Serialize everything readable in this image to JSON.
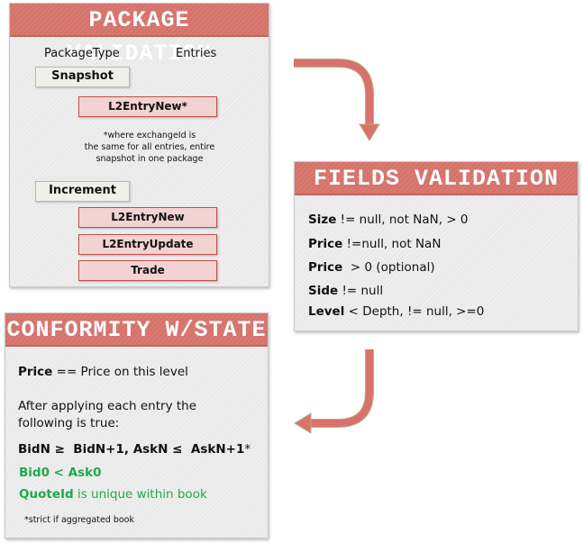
{
  "package_validation": {
    "title": "PACKAGE VALIDATION",
    "col_package_type": "PackageType",
    "col_entries": "Entries",
    "snapshot": {
      "label": "Snapshot",
      "entries": [
        "L2EntryNew*"
      ],
      "note": [
        "*where exchangeId is",
        "the same for all entries, entire",
        "snapshot in one package"
      ]
    },
    "increment": {
      "label": "Increment",
      "entries": [
        "L2EntryNew",
        "L2EntryUpdate",
        "Trade"
      ]
    }
  },
  "fields_validation": {
    "title": "FIELDS VALIDATION",
    "rules": [
      {
        "field": "Size",
        "rule": " != null, not NaN, > 0"
      },
      {
        "field": "Price",
        "rule": " !=null, not NaN"
      },
      {
        "field": "Price",
        "rule": "  > 0 (optional)"
      },
      {
        "field": "Side",
        "rule": " != null"
      },
      {
        "field": "Level",
        "rule": " < Depth, != null, >=0"
      }
    ]
  },
  "conformity": {
    "title": "CONFORMITY W/STATE",
    "price_field": "Price",
    "price_rule": " == Price on this level",
    "after_line1": "After applying each entry the",
    "after_line2": "following is true:",
    "ordering": "BidN ≥  BidN+1, AskN ≤  AskN+1",
    "ordering_mark": "*",
    "bid_ask": "Bid0 < Ask0",
    "quote_field": "QuoteId",
    "quote_rule": " is unique within book",
    "footnote": "*strict if aggregated book"
  },
  "colors": {
    "header": "#d97a73",
    "entry_fill": "#f3d3d1",
    "entry_border": "#c0504d",
    "green": "#1faa4a",
    "arrow": "#d9726c"
  }
}
